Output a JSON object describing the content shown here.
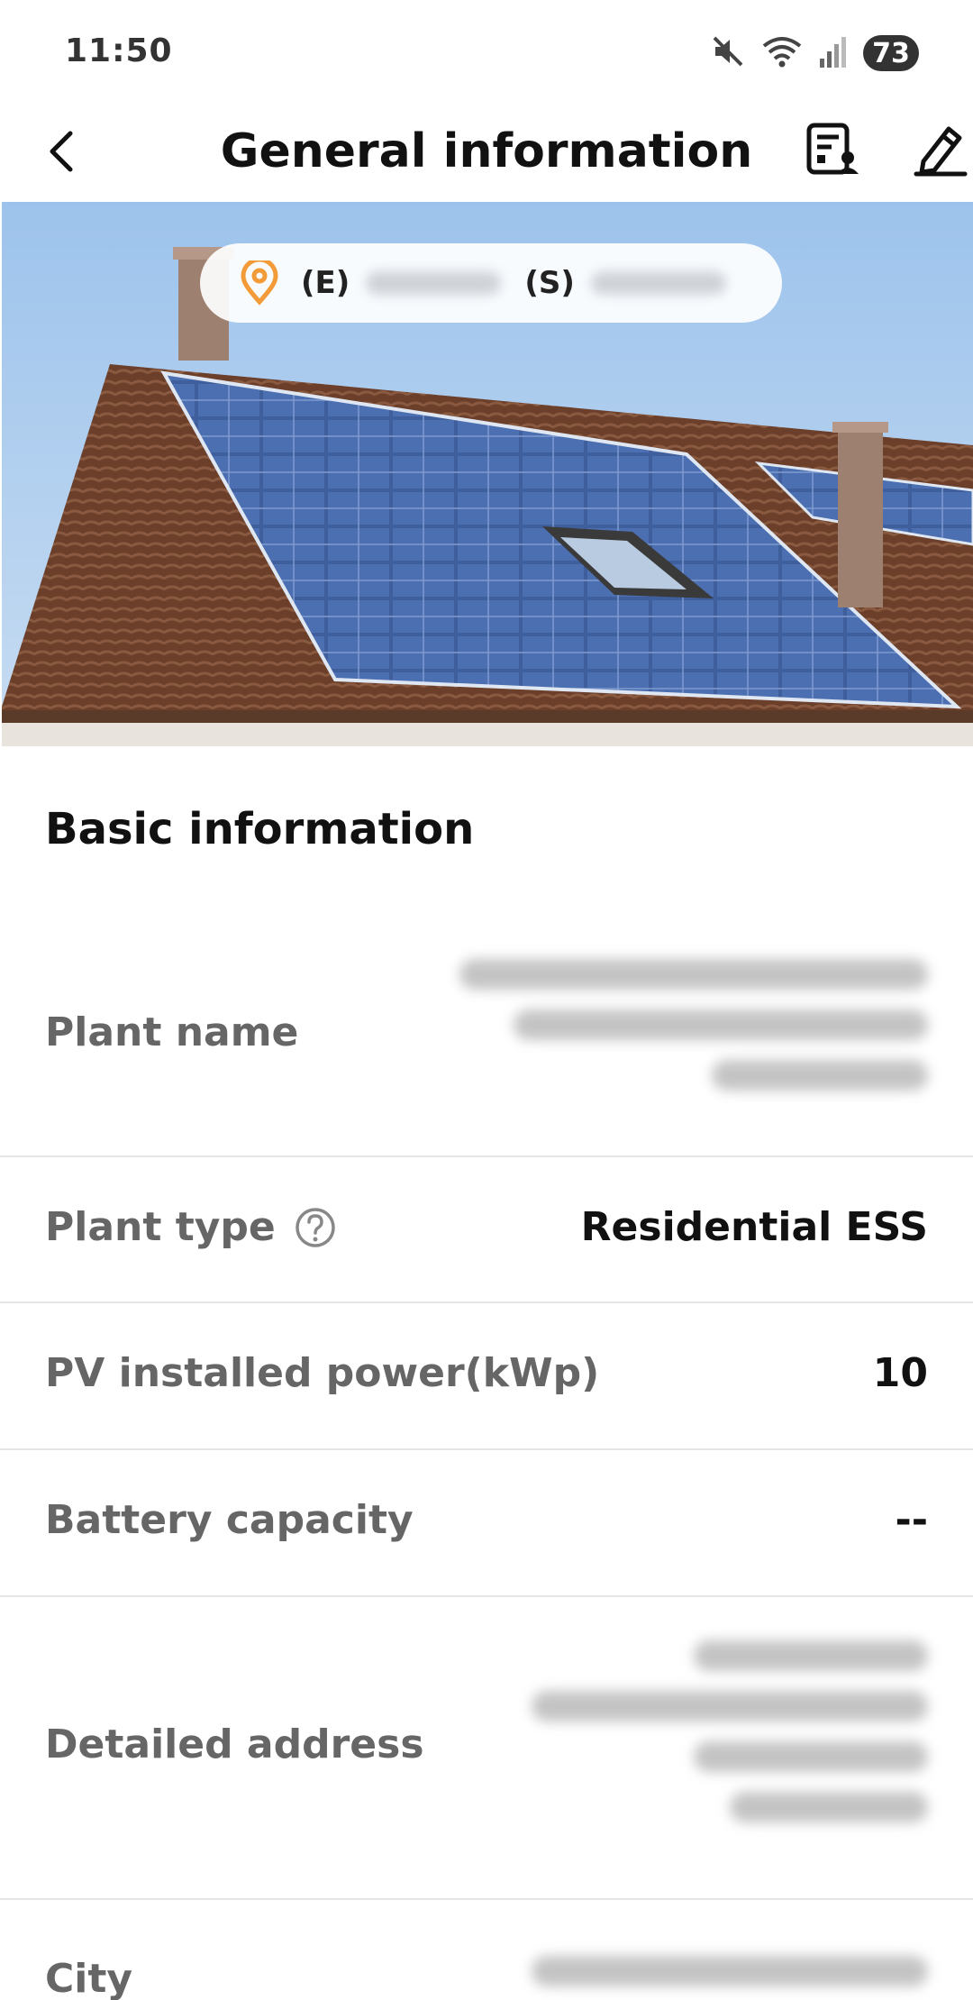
{
  "status_bar": {
    "time": "11:50",
    "battery": "73",
    "icons": [
      "mute-icon",
      "wifi-icon",
      "signal-icon"
    ]
  },
  "header": {
    "title": "General information",
    "back_icon": "chevron-left-icon",
    "report_icon": "report-icon",
    "edit_icon": "edit-icon"
  },
  "hero": {
    "location_icon": "location-pin-icon",
    "east_label": "(E)",
    "south_label": "(S)"
  },
  "basic_info": {
    "title": "Basic information",
    "rows": [
      {
        "label": "Plant name",
        "value": ""
      },
      {
        "label": "Plant type",
        "value": "Residential ESS"
      },
      {
        "label": "PV installed power(kWp)",
        "value": "10"
      },
      {
        "label": "Battery capacity",
        "value": "--"
      },
      {
        "label": "Detailed address",
        "value": ""
      },
      {
        "label": "City",
        "value": ""
      }
    ]
  },
  "colors": {
    "accent": "#f29b38",
    "label": "#666666",
    "divider": "#e6e6e6"
  }
}
